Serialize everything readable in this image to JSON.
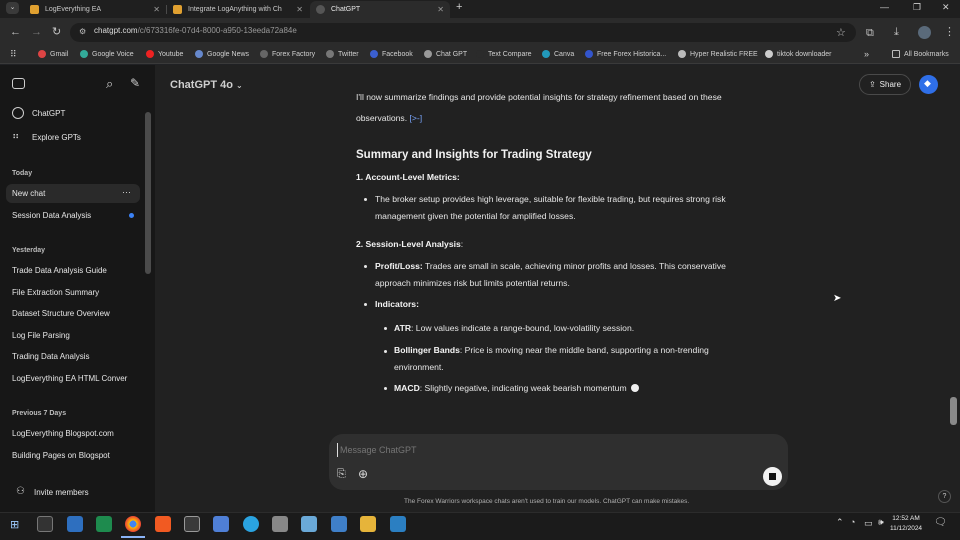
{
  "browser": {
    "tabs": [
      {
        "title": "LogEverything EA"
      },
      {
        "title": "Integrate LogAnything with Ch"
      },
      {
        "title": "ChatGPT"
      }
    ],
    "new_tab": "+",
    "url_host": "chatgpt.com",
    "url_path": "/c/673316fe-07d4-8000-a950-13eeda72a84e",
    "bookmarks": [
      "Gmail",
      "Google Voice",
      "Youtube",
      "Google News",
      "Forex Factory",
      "Twitter",
      "Facebook",
      "Chat GPT",
      "Text Compare",
      "Canva",
      "Free Forex Historica...",
      "Hyper Realistic FREE",
      "tiktok downloader"
    ],
    "more_bookmarks": "»",
    "all_bookmarks": "All Bookmarks"
  },
  "sidebar": {
    "top_items": [
      "ChatGPT",
      "Explore GPTs"
    ],
    "sections": [
      {
        "heading": "Today",
        "items": [
          "New chat",
          "Session Data Analysis"
        ]
      },
      {
        "heading": "Yesterday",
        "items": [
          "Trade Data Analysis Guide",
          "File Extraction Summary",
          "Dataset Structure Overview",
          "Log File Parsing",
          "Trading Data Analysis",
          "LogEverything EA HTML Conver"
        ]
      },
      {
        "heading": "Previous 7 Days",
        "items": [
          "LogEverything Blogspot.com",
          "Building Pages on Blogspot"
        ]
      }
    ],
    "more_dots": "···",
    "invite": "Invite members"
  },
  "header": {
    "model": "ChatGPT 4o",
    "share": "Share"
  },
  "conversation": {
    "intro_line1": "I'll now summarize findings and provide potential insights for strategy refinement based on these",
    "intro_line2": "observations.",
    "intro_ref": "[>-]",
    "heading": "Summary and Insights for Trading Strategy",
    "section1_title": "1. Account-Level Metrics:",
    "section1_b1_line1": "The broker setup provides high leverage, suitable for flexible trading, but requires strong risk",
    "section1_b1_line2": "management given the potential for amplified losses.",
    "section2_title": "2. Session-Level Analysis",
    "section2_colon": ":",
    "pl_label": "Profit/Loss:",
    "pl_line1": " Trades are small in scale, achieving minor profits and losses. This conservative",
    "pl_line2": "approach minimizes risk but limits potential returns.",
    "indicators_label": "Indicators:",
    "atr_label": "ATR",
    "atr_text": ": Low values indicate a range-bound, low-volatility session.",
    "bb_label": "Bollinger Bands",
    "bb_text": ": Price is moving near the middle band, supporting a non-trending",
    "bb_line2": "environment.",
    "macd_label": "MACD",
    "macd_text": ": Slightly negative, indicating weak bearish momentum"
  },
  "composer": {
    "placeholder": "Message ChatGPT"
  },
  "footer_note": "The Forex Warriors workspace chats aren't used to train our models. ChatGPT can make mistakes.",
  "help": "?",
  "taskbar": {
    "time": "12:52 AM",
    "date": "11/12/2024"
  }
}
